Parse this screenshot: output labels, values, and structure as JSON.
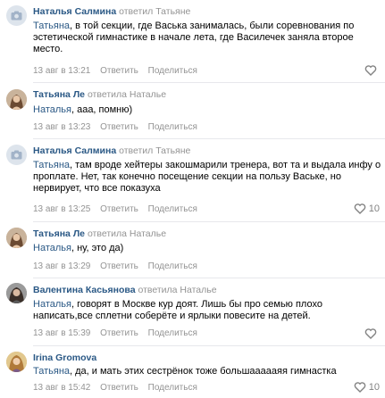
{
  "comments": [
    {
      "author": "Наталья Салмина",
      "replied": "ответил Татьяне",
      "addressee": "Татьяна",
      "text": ", в той секции, где Васька занималась, были соревнования по эстетической гимнастике в начале лета, где Василечек заняла второе место.",
      "time": "13 авг в 13:21",
      "reply_label": "Ответить",
      "share_label": "Поделиться",
      "likes": ""
    },
    {
      "author": "Татьяна Ле",
      "replied": "ответила Наталье",
      "addressee": "Наталья",
      "text": ", ааа, помню)",
      "time": "13 авг в 13:23",
      "reply_label": "Ответить",
      "share_label": "Поделиться",
      "likes": ""
    },
    {
      "author": "Наталья Салмина",
      "replied": "ответил Татьяне",
      "addressee": "Татьяна",
      "text": ", там вроде хейтеры закошмарили тренера, вот та и выдала инфу о проплате. Нет, так конечно посещение секции на пользу Ваське, но нервирует, что все показуха",
      "time": "13 авг в 13:25",
      "reply_label": "Ответить",
      "share_label": "Поделиться",
      "likes": "10"
    },
    {
      "author": "Татьяна Ле",
      "replied": "ответила Наталье",
      "addressee": "Наталья",
      "text": ", ну, это да)",
      "time": "13 авг в 13:29",
      "reply_label": "Ответить",
      "share_label": "Поделиться",
      "likes": ""
    },
    {
      "author": "Валентина Касьянова",
      "replied": "ответила Наталье",
      "addressee": "Наталья",
      "text": ", говорят в Москве кур доят. Лишь бы про семью плохо написать,все сплетни соберёте и ярлыки повесите на детей.",
      "time": "13 авг в 15:39",
      "reply_label": "Ответить",
      "share_label": "Поделиться",
      "likes": ""
    },
    {
      "author": "Irina Gromova",
      "replied": "",
      "addressee": "Татьяна",
      "text": ", да, и мать этих сестрёнок тоже большаааааяя гимнастка",
      "time": "13 авг в 15:42",
      "reply_label": "Ответить",
      "share_label": "Поделиться",
      "likes": "10"
    }
  ],
  "colors": {
    "link": "#2a5885",
    "muted": "#939393",
    "divider": "#e7e8ec"
  },
  "icons": {
    "camera": "camera-icon",
    "heart": "heart-icon"
  }
}
